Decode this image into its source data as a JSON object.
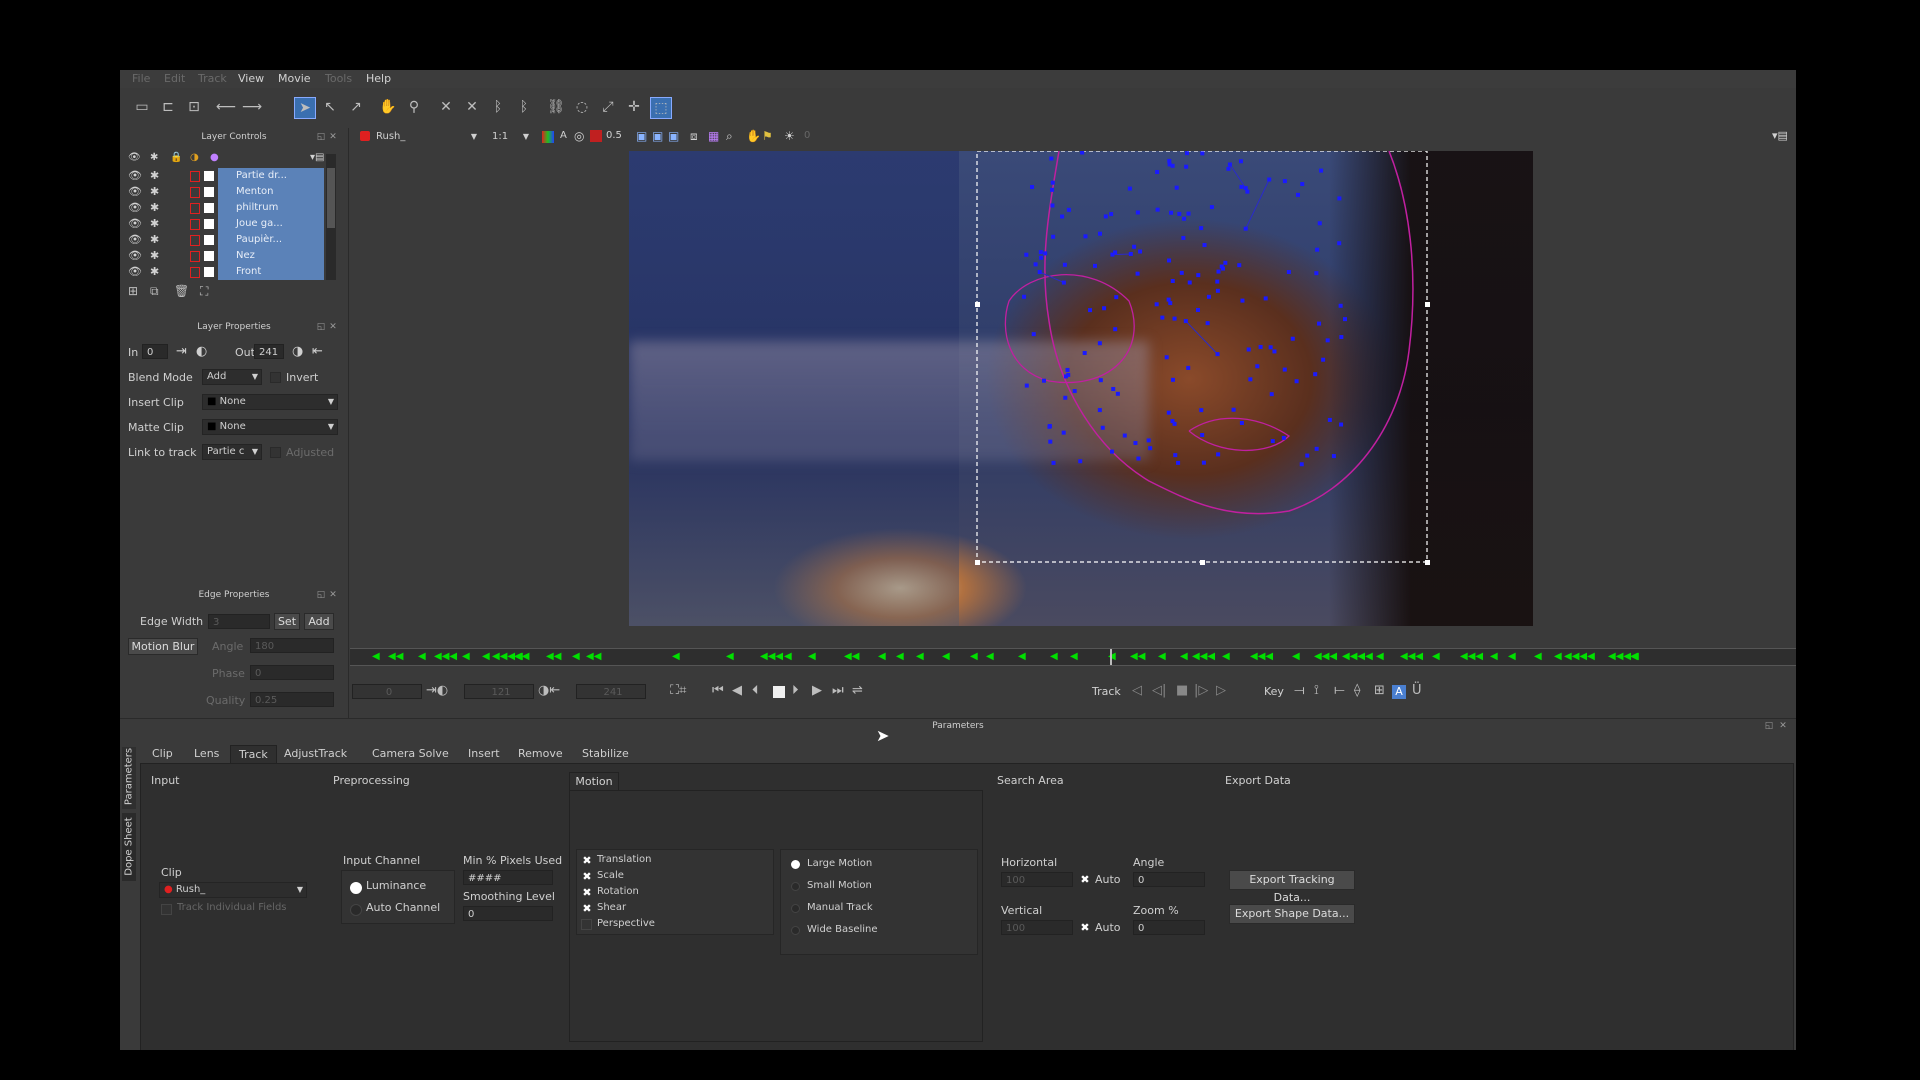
{
  "menubar": {
    "items": [
      "File",
      "Edit",
      "Track",
      "View",
      "Movie",
      "Tools",
      "Help"
    ],
    "disabled": [
      true,
      true,
      true,
      false,
      false,
      true,
      false
    ]
  },
  "layer_controls": {
    "title": "Layer Controls",
    "layers": [
      "Partie dr...",
      "Menton",
      "philtrum",
      "Joue ga...",
      "Paupièr...",
      "Nez",
      "Front"
    ]
  },
  "layer_properties": {
    "title": "Layer Properties",
    "in_label": "In",
    "in_value": "0",
    "out_label": "Out",
    "out_value": "241",
    "blend_label": "Blend Mode",
    "blend_value": "Add",
    "invert_label": "Invert",
    "insert_label": "Insert Clip",
    "insert_value": "None",
    "matte_label": "Matte Clip",
    "matte_value": "None",
    "link_label": "Link to track",
    "link_value": "Partie c",
    "adjusted_label": "Adjusted"
  },
  "edge_properties": {
    "title": "Edge Properties",
    "edge_width_label": "Edge Width",
    "edge_width_value": "3",
    "set_label": "Set",
    "add_label": "Add",
    "motion_blur_label": "Motion Blur",
    "angle_label": "Angle",
    "angle_value": "180",
    "phase_label": "Phase",
    "phase_value": "0",
    "quality_label": "Quality",
    "quality_value": "0.25"
  },
  "viewer": {
    "clip_name": "Rush_",
    "zoom": "1:1",
    "opacity": "0.5",
    "frame_marker": "0"
  },
  "transport": {
    "frame_start": "0",
    "frame_mid": "121",
    "frame_end": "241",
    "track_label": "Track",
    "key_label": "Key"
  },
  "params": {
    "title": "Parameters",
    "side_tabs": [
      "Parameters",
      "Dope Sheet"
    ],
    "tabs": [
      "Clip",
      "Lens",
      "Track",
      "AdjustTrack",
      "Camera Solve",
      "Insert",
      "Remove",
      "Stabilize"
    ],
    "active_tab": "Track",
    "input_title": "Input",
    "preprocessing_title": "Preprocessing",
    "motion_tab": "Motion",
    "search_title": "Search Area",
    "export_title": "Export Data",
    "clip_label": "Clip",
    "clip_value": "Rush_",
    "track_fields_label": "Track Individual Fields",
    "input_channel_label": "Input Channel",
    "luminance_label": "Luminance",
    "auto_channel_label": "Auto Channel",
    "min_pixels_label": "Min % Pixels Used",
    "min_pixels_value": "####",
    "smoothing_label": "Smoothing Level",
    "smoothing_value": "0",
    "motion_options": [
      "Translation",
      "Scale",
      "Rotation",
      "Shear",
      "Perspective"
    ],
    "motion_checked": [
      true,
      true,
      true,
      true,
      false
    ],
    "motion_modes": [
      "Large Motion",
      "Small Motion",
      "Manual Track",
      "Wide Baseline"
    ],
    "horizontal_label": "Horizontal",
    "horizontal_value": "100",
    "angle_label": "Angle",
    "angle_value": "0",
    "vertical_label": "Vertical",
    "vertical_value": "100",
    "zoom_label": "Zoom %",
    "zoom_value": "0",
    "auto_label": "Auto",
    "export_tracking_label": "Export Tracking Data...",
    "export_shape_label": "Export Shape Data..."
  },
  "colors": {
    "accent": "#3a6fb0",
    "keyframe": "#00e000",
    "tracker": "#1a1aff",
    "spline": "#c020a0",
    "layer_sel": "#5b82b8",
    "record": "#e02020"
  }
}
